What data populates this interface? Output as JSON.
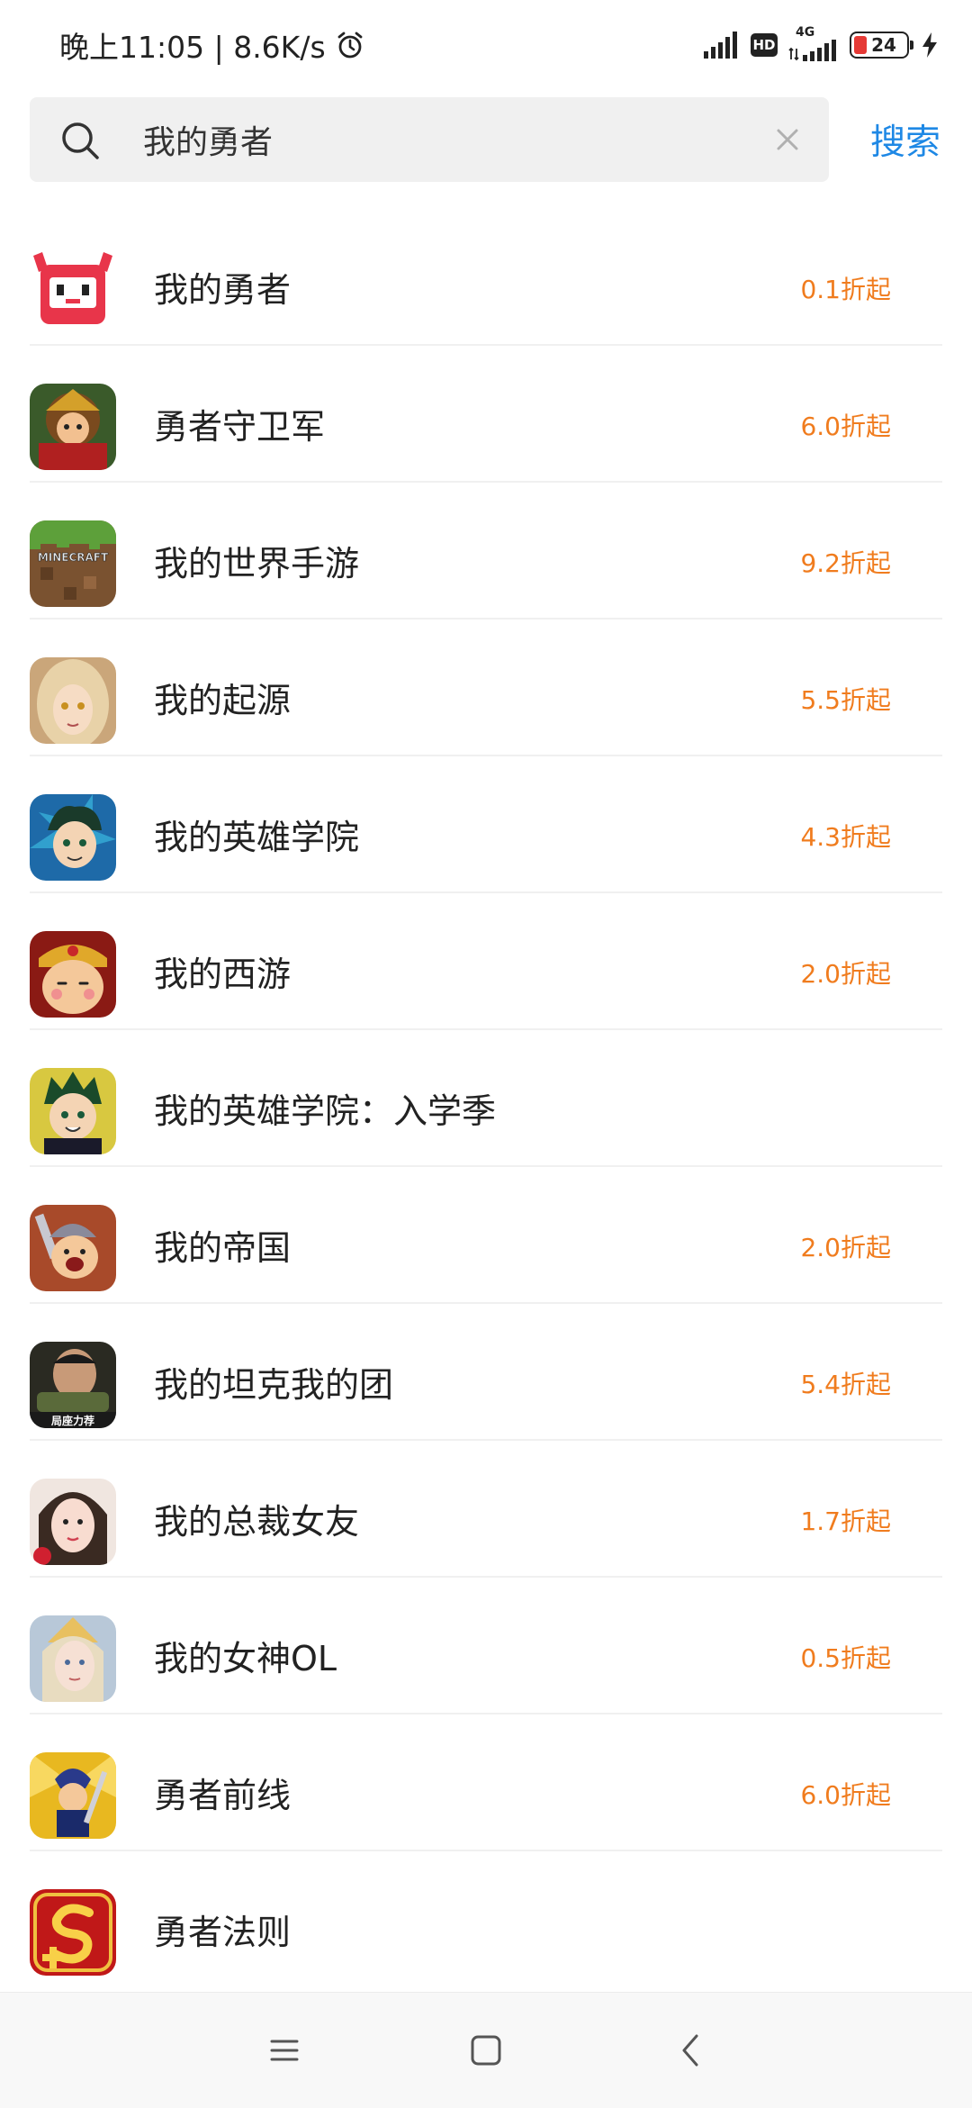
{
  "status_bar": {
    "time_network": "晚上11:05 | 8.6K/s",
    "hd_label": "HD",
    "network_label": "4G",
    "battery_level": "24",
    "icons": [
      "alarm-icon",
      "signal-icon",
      "hd-icon",
      "signal-4g-icon",
      "battery-icon",
      "charging-icon"
    ]
  },
  "search": {
    "query": "我的勇者",
    "button_label": "搜索",
    "icons": [
      "search-icon",
      "clear-icon"
    ]
  },
  "results": [
    {
      "name": "我的勇者",
      "discount": "0.1折起"
    },
    {
      "name": "勇者守卫军",
      "discount": "6.0折起"
    },
    {
      "name": "我的世界手游",
      "discount": "9.2折起"
    },
    {
      "name": "我的起源",
      "discount": "5.5折起"
    },
    {
      "name": "我的英雄学院",
      "discount": "4.3折起"
    },
    {
      "name": "我的西游",
      "discount": "2.0折起"
    },
    {
      "name": "我的英雄学院：入学季",
      "discount": ""
    },
    {
      "name": "我的帝国",
      "discount": "2.0折起"
    },
    {
      "name": "我的坦克我的团",
      "discount": "5.4折起"
    },
    {
      "name": "我的总裁女友",
      "discount": "1.7折起"
    },
    {
      "name": "我的女神OL",
      "discount": "0.5折起"
    },
    {
      "name": "勇者前线",
      "discount": "6.0折起"
    },
    {
      "name": "勇者法则",
      "discount": ""
    }
  ],
  "app_icon_texts": {
    "minecraft": "MINECRAFT",
    "tank_badge": "局座力荐"
  },
  "colors": {
    "accent_blue": "#1e88e5",
    "discount_orange": "#f07c1e",
    "search_bg": "#f0f0f0"
  },
  "nav_bar": {
    "icons": [
      "menu-icon",
      "home-icon",
      "back-icon"
    ]
  }
}
